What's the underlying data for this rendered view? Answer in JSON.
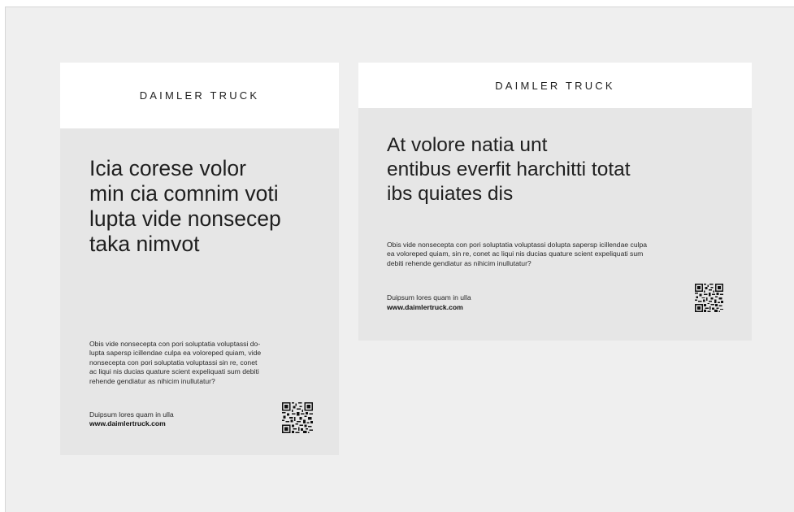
{
  "card_portrait": {
    "brand": "DAIMLER TRUCK",
    "headline": [
      "Icia corese volor",
      "min cia comnim voti",
      "lupta vide nonsecep",
      "taka nimvot"
    ],
    "body": [
      "Obis vide nonsecepta con pori soluptatia voluptassi do-",
      "lupta sapersp icillendae culpa ea voloreped quiam, vide",
      "nonsecepta con pori soluptatia voluptassi sin re, conet",
      "ac liqui nis ducias quature scient expeliquati sum debiti",
      "rehende gendiatur as nihicim inullutatur?"
    ],
    "footer_text": "Duipsum lores quam in ulla",
    "url": "www.daimlertruck.com",
    "qr_icon": "qr-code-icon"
  },
  "card_landscape": {
    "brand": "DAIMLER TRUCK",
    "headline": [
      "At volore natia unt",
      "entibus everfit harchitti totat",
      "ibs quiates dis"
    ],
    "body": [
      "Obis vide nonsecepta con pori soluptatia voluptassi dolupta sapersp icillendae culpa",
      "ea voloreped quiam, sin re, conet ac liqui nis ducias quature scient expeliquati sum",
      "debiti rehende gendiatur as nihicim inullutatur?"
    ],
    "footer_text": "Duipsum lores quam in ulla",
    "url": "www.daimlertruck.com",
    "qr_icon": "qr-code-icon"
  },
  "colors": {
    "canvas": "#efefef",
    "card": "#e6e6e6",
    "header": "#ffffff",
    "text": "#1f1f1f"
  }
}
